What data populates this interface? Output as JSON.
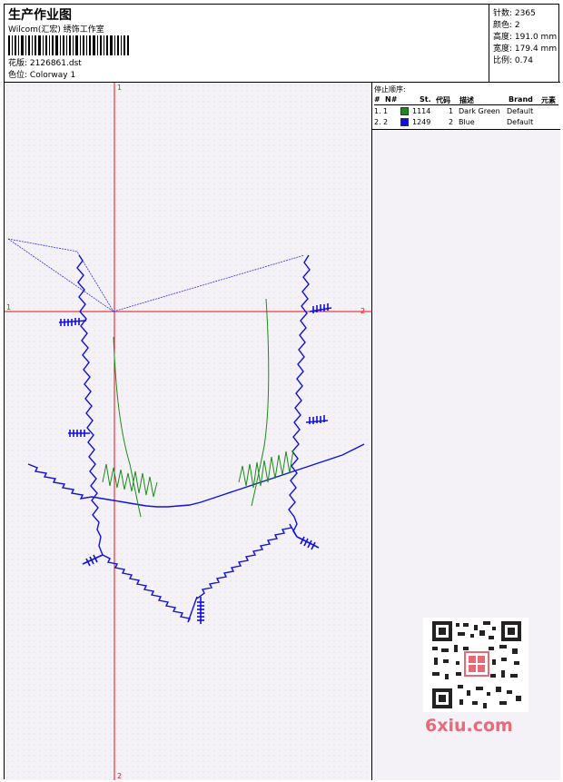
{
  "header": {
    "title": "生产作业图",
    "studio": "Wilcom(汇宏) 绣饰工作室",
    "design_label": "花版:",
    "design_file": "2126861.dst",
    "colorway_label": "色位:",
    "colorway": "Colorway 1"
  },
  "stats": {
    "stitches_label": "针数:",
    "stitches": "2365",
    "colors_label": "颜色:",
    "colors": "2",
    "height_label": "高度:",
    "height": "191.0 mm",
    "width_label": "宽度:",
    "width": "179.4 mm",
    "scale_label": "比例:",
    "scale": "0.74"
  },
  "stop_sequence": {
    "title": "停止顺序:",
    "columns": [
      "#",
      "N#",
      "St.",
      "代码",
      "描述",
      "Brand",
      "元素"
    ],
    "rows": [
      {
        "index": "1.",
        "needle": "1",
        "color": "#1a8c1a",
        "stitches": "1114",
        "code": "1",
        "description": "Dark Green",
        "brand": "Default"
      },
      {
        "index": "2.",
        "needle": "2",
        "color": "#1010e0",
        "stitches": "1249",
        "code": "2",
        "description": "Blue",
        "brand": "Default"
      }
    ]
  },
  "axes": {
    "top_label": "1",
    "bottom_label": "2",
    "left_label": "1",
    "right_label": "2"
  },
  "watermark": "6xiu.com",
  "colors": {
    "axis": "#e0101a",
    "blue_thread": "#1010e0",
    "green_thread": "#1a8c1a",
    "jump_line": "#3030e8"
  }
}
